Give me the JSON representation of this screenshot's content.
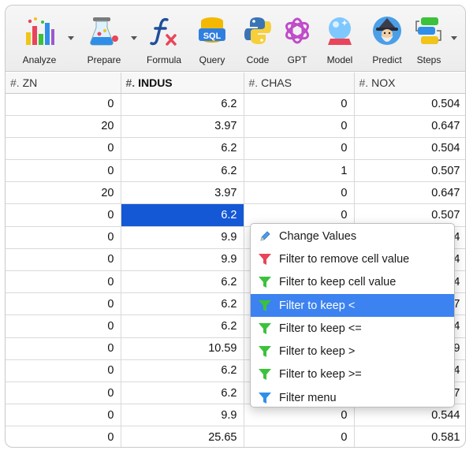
{
  "toolbar": {
    "tools": [
      {
        "label": "Analyze",
        "icon": "bar-chart-icon"
      },
      {
        "label": "Prepare",
        "icon": "flask-icon"
      },
      {
        "label": "Formula",
        "icon": "function-icon"
      },
      {
        "label": "Query",
        "icon": "sql-icon"
      },
      {
        "label": "Code",
        "icon": "python-icon"
      },
      {
        "label": "GPT",
        "icon": "gpt-icon"
      },
      {
        "label": "Model",
        "icon": "crystal-ball-icon"
      },
      {
        "label": "Predict",
        "icon": "wizard-icon"
      },
      {
        "label": "Steps",
        "icon": "steps-icon"
      }
    ]
  },
  "grid": {
    "columns": [
      {
        "type": "#.",
        "name": "ZN"
      },
      {
        "type": "#.",
        "name": "INDUS"
      },
      {
        "type": "#.",
        "name": "CHAS"
      },
      {
        "type": "#.",
        "name": "NOX"
      }
    ],
    "rows": [
      [
        "0",
        "6.2",
        "0",
        "0.504"
      ],
      [
        "20",
        "3.97",
        "0",
        "0.647"
      ],
      [
        "0",
        "6.2",
        "0",
        "0.504"
      ],
      [
        "0",
        "6.2",
        "1",
        "0.507"
      ],
      [
        "20",
        "3.97",
        "0",
        "0.647"
      ],
      [
        "0",
        "6.2",
        "0",
        "0.507"
      ],
      [
        "0",
        "9.9",
        "",
        "44"
      ],
      [
        "0",
        "9.9",
        "",
        "44"
      ],
      [
        "0",
        "6.2",
        "",
        "04"
      ],
      [
        "0",
        "6.2",
        "",
        "07"
      ],
      [
        "0",
        "6.2",
        "",
        "04"
      ],
      [
        "0",
        "10.59",
        "",
        "89"
      ],
      [
        "0",
        "6.2",
        "",
        "04"
      ],
      [
        "0",
        "6.2",
        "",
        "07"
      ],
      [
        "0",
        "9.9",
        "0",
        "0.544"
      ],
      [
        "0",
        "25.65",
        "0",
        "0.581"
      ]
    ]
  },
  "context_menu": {
    "items": [
      {
        "label": "Change Values",
        "icon": "edit-pencil-icon"
      },
      {
        "label": "Filter to remove cell value",
        "icon": "filter-red-icon"
      },
      {
        "label": "Filter to keep cell value",
        "icon": "filter-green-icon"
      },
      {
        "label": "Filter to keep <",
        "icon": "filter-green-icon"
      },
      {
        "label": "Filter to keep <=",
        "icon": "filter-green-icon"
      },
      {
        "label": "Filter to keep >",
        "icon": "filter-green-icon"
      },
      {
        "label": "Filter to keep >=",
        "icon": "filter-green-icon"
      },
      {
        "label": "Filter menu",
        "icon": "filter-blue-icon"
      }
    ],
    "active_label": "Filter to keep <"
  },
  "colors": {
    "selection": "#1558d6",
    "menu_highlight": "#3c82f0",
    "filter_red": "#e8455a",
    "filter_green": "#3cc13c",
    "filter_blue": "#2f8fe8"
  }
}
